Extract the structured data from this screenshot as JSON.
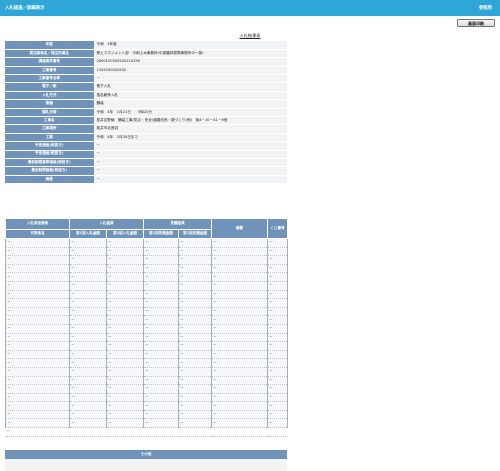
{
  "header": {
    "title": "入札経過／詳細表示",
    "right_label": "参照用"
  },
  "toolbar": {
    "print_label": "画面印刷"
  },
  "section_title": "入札結果表",
  "info_rows": [
    {
      "label": "年度",
      "value": "令和　3年度"
    },
    {
      "label": "発注部局名／発注所属名",
      "value": "県土マネジメント部　中和土木事務所(中部農林振興事務所の一部)"
    },
    {
      "label": "調達案件番号",
      "value": "2800100305200210290"
    },
    {
      "label": "工事番号",
      "value": "1305200020532"
    },
    {
      "label": "工事番号名称",
      "value": "－"
    },
    {
      "label": "電子／紙",
      "value": "電子入札"
    },
    {
      "label": "入札方式",
      "value": "指名競争入札"
    },
    {
      "label": "業種",
      "value": "舗装"
    },
    {
      "label": "開札日時",
      "value": "令和　4年　1月21日　　9時20分"
    },
    {
      "label": "工事名",
      "value": "桜井吉野線　舗装工事(防災・安全(道路改良・駅づくり)他)　後4－10－A1－6他"
    },
    {
      "label": "工事場所",
      "value": "桜井市北音羽"
    },
    {
      "label": "工期",
      "value": "令和　4年　2月30日まで"
    },
    {
      "label": "予定価格(税抜き)",
      "value": "－"
    },
    {
      "label": "予定価格(税抜き)",
      "value": "－"
    },
    {
      "label": "最低制限基準価格(税抜き)",
      "value": "－"
    },
    {
      "label": "最低制限価格(税抜き)",
      "value": "－"
    },
    {
      "label": "摘要",
      "value": "－"
    }
  ],
  "bids": {
    "group_headers": {
      "company": "入札参加業者",
      "bid": "入札結果",
      "estimate": "見積結果",
      "remarks": "摘要",
      "kuji": "くじ番号"
    },
    "sub_headers": {
      "company_name": "代表者名",
      "bid_first": "第1回入札金額",
      "bid_second": "第2回入札金額",
      "est_first": "第1回見積金額",
      "est_second": "第2回見積金額"
    },
    "dash": "－",
    "row_count": 22
  },
  "other": {
    "title": "その他"
  }
}
